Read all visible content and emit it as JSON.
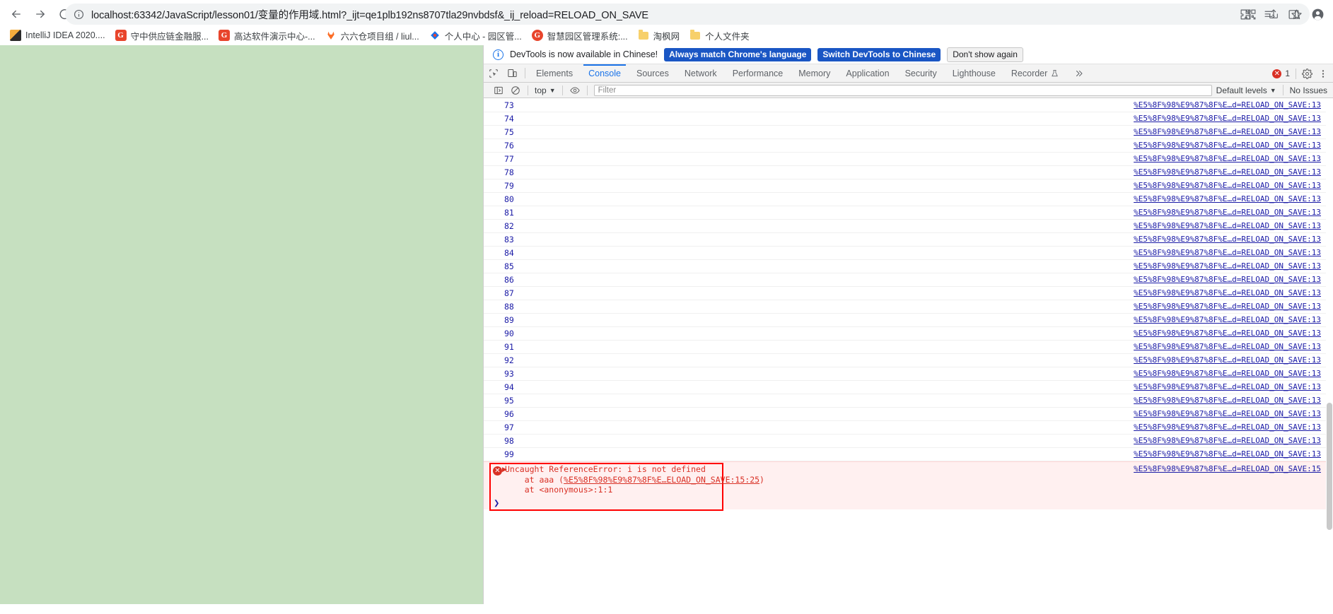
{
  "browser": {
    "nav": {
      "back_icon": "arrow-left-icon",
      "forward_icon": "arrow-right-icon",
      "reload_icon": "reload-icon",
      "info_icon": "site-info-icon",
      "url": "localhost:63342/JavaScript/lesson01/变量的作用域.html?_ijt=qe1plb192ns8707tla29nvbdsf&_ij_reload=RELOAD_ON_SAVE",
      "qr_icon": "qr-code-icon",
      "share_icon": "share-icon",
      "star_icon": "bookmark-star-icon",
      "extensions_icon": "extensions-puzzle-icon",
      "readlist_icon": "reading-list-icon",
      "sidepanel_icon": "side-panel-icon",
      "profile_icon": "profile-avatar-icon"
    },
    "bookmarks": [
      {
        "label": "IntelliJ IDEA 2020....",
        "icon": "intellij-idea-icon",
        "icon_kind": "idea"
      },
      {
        "label": "守中供应链金融服...",
        "icon": "g-favicon",
        "icon_kind": "g"
      },
      {
        "label": "高达软件演示中心-...",
        "icon": "g-favicon",
        "icon_kind": "g"
      },
      {
        "label": "六六仓项目组 / liul...",
        "icon": "gitlab-fox-icon",
        "icon_kind": "fox"
      },
      {
        "label": "个人中心 - 园区管...",
        "icon": "blue-diamond-icon",
        "icon_kind": "blue"
      },
      {
        "label": "智慧园区管理系统:...",
        "icon": "g-favicon-round",
        "icon_kind": "g2"
      },
      {
        "label": "淘枫网",
        "icon": "folder-icon",
        "icon_kind": "folder"
      },
      {
        "label": "个人文件夹",
        "icon": "folder-icon",
        "icon_kind": "folder"
      }
    ]
  },
  "devtools": {
    "banner": {
      "info_icon": "info-icon",
      "message": "DevTools is now available in Chinese!",
      "primary_button": "Always match Chrome's language",
      "secondary_button": "Switch DevTools to Chinese",
      "dismiss_button": "Don't show again"
    },
    "toolbar": {
      "inspect_icon": "inspect-element-icon",
      "device_icon": "device-toolbar-icon",
      "tabs": [
        {
          "label": "Elements",
          "active": false
        },
        {
          "label": "Console",
          "active": true
        },
        {
          "label": "Sources",
          "active": false
        },
        {
          "label": "Network",
          "active": false
        },
        {
          "label": "Performance",
          "active": false
        },
        {
          "label": "Memory",
          "active": false
        },
        {
          "label": "Application",
          "active": false
        },
        {
          "label": "Security",
          "active": false
        },
        {
          "label": "Lighthouse",
          "active": false
        },
        {
          "label": "Recorder",
          "active": false
        }
      ],
      "recorder_flask_icon": "flask-experiment-icon",
      "more_tabs_icon": "chevron-double-right-icon",
      "error_count": "1",
      "settings_icon": "gear-icon",
      "more_icon": "kebab-menu-icon"
    },
    "filterbar": {
      "sidebar_icon": "console-sidebar-icon",
      "clear_icon": "clear-console-icon",
      "context": "top",
      "context_caret": "chevron-down-icon",
      "eye_icon": "live-expression-eye-icon",
      "filter_placeholder": "Filter",
      "levels": "Default levels",
      "levels_caret": "chevron-down-icon",
      "issues": "No Issues"
    },
    "console": {
      "source_link": "%E5%8F%98%E9%87%8F%E…d=RELOAD_ON_SAVE:13",
      "error_source_link": "%E5%8F%98%E9%87%8F%E…d=RELOAD_ON_SAVE:15",
      "rows": [
        {
          "num": "73"
        },
        {
          "num": "74"
        },
        {
          "num": "75"
        },
        {
          "num": "76"
        },
        {
          "num": "77"
        },
        {
          "num": "78"
        },
        {
          "num": "79"
        },
        {
          "num": "80"
        },
        {
          "num": "81"
        },
        {
          "num": "82"
        },
        {
          "num": "83"
        },
        {
          "num": "84"
        },
        {
          "num": "85"
        },
        {
          "num": "86"
        },
        {
          "num": "87"
        },
        {
          "num": "88"
        },
        {
          "num": "89"
        },
        {
          "num": "90"
        },
        {
          "num": "91"
        },
        {
          "num": "92"
        },
        {
          "num": "93"
        },
        {
          "num": "94"
        },
        {
          "num": "95"
        },
        {
          "num": "96"
        },
        {
          "num": "97"
        },
        {
          "num": "98"
        },
        {
          "num": "99"
        }
      ],
      "error": {
        "expand_icon": "expand-triangle-icon",
        "error_icon": "error-circle-icon",
        "line1": "Uncaught ReferenceError: i is not defined",
        "line2_prefix": "    at aaa (",
        "line2_link": "%E5%8F%98%E9%87%8F%E…ELOAD_ON_SAVE:15:25",
        "line2_suffix": ")",
        "line3": "    at <anonymous>:1:1"
      },
      "prompt_caret": "prompt-caret-icon"
    }
  },
  "colors": {
    "page_background": "#c6e0c0",
    "accent_blue": "#1a73e8",
    "error_red": "#d93025",
    "error_border": "#ff0000",
    "error_bg": "#fff0f0",
    "devtools_chrome": "#f3f3f3"
  }
}
